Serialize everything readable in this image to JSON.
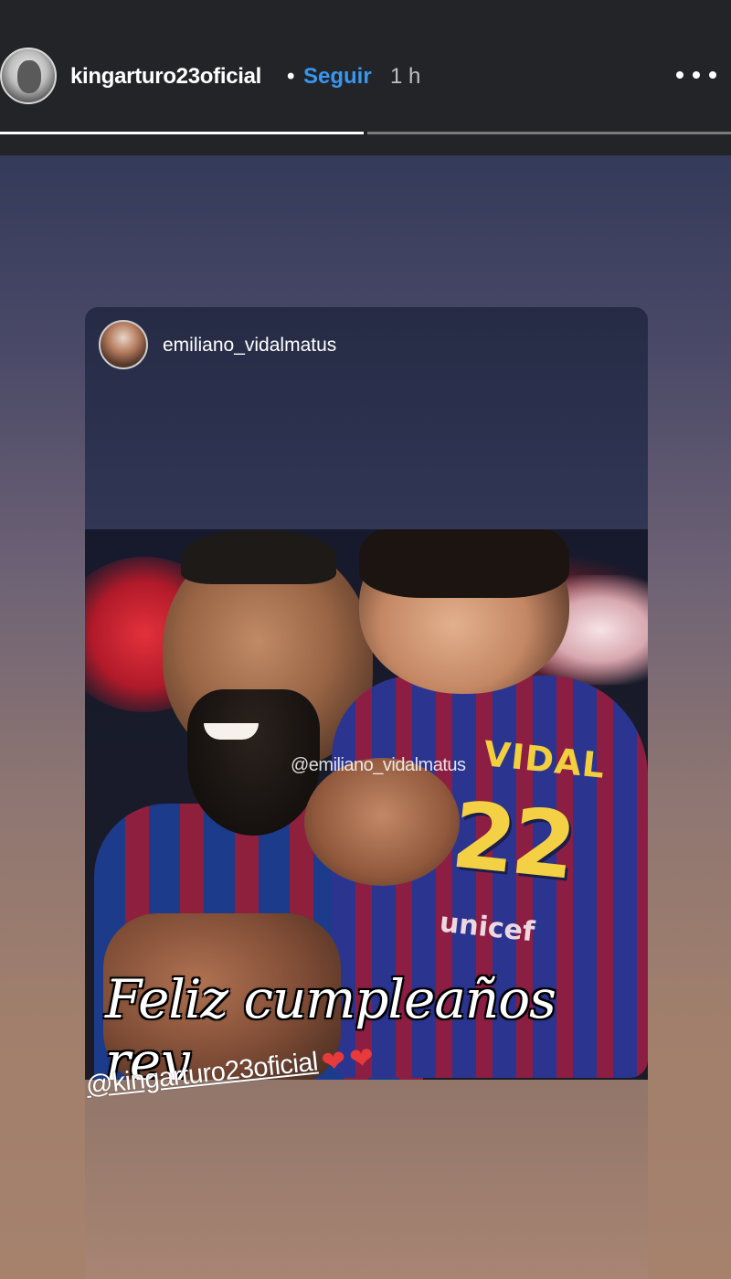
{
  "header": {
    "username": "kingarturo23oficial",
    "separator": "•",
    "follow_label": "Seguir",
    "time_ago": "1 h",
    "more_icon": "more-horizontal-icon"
  },
  "story_progress": {
    "segments_total": 2,
    "segments_viewed": 1
  },
  "shared_post": {
    "username": "emiliano_vidalmatus",
    "photo": {
      "watermark": "@emiliano_vidalmatus",
      "jersey_name": "VIDAL",
      "jersey_number": "22",
      "sponsor": "unicef",
      "overlay_text": "Feliz cumpleaños rey"
    }
  },
  "mention": {
    "text": "@kingarturo23oficial",
    "hearts": [
      "❤",
      "❤"
    ]
  },
  "colors": {
    "top_bar": "#232427",
    "follow_blue": "#3897f0",
    "heart_red": "#e83a3a"
  }
}
